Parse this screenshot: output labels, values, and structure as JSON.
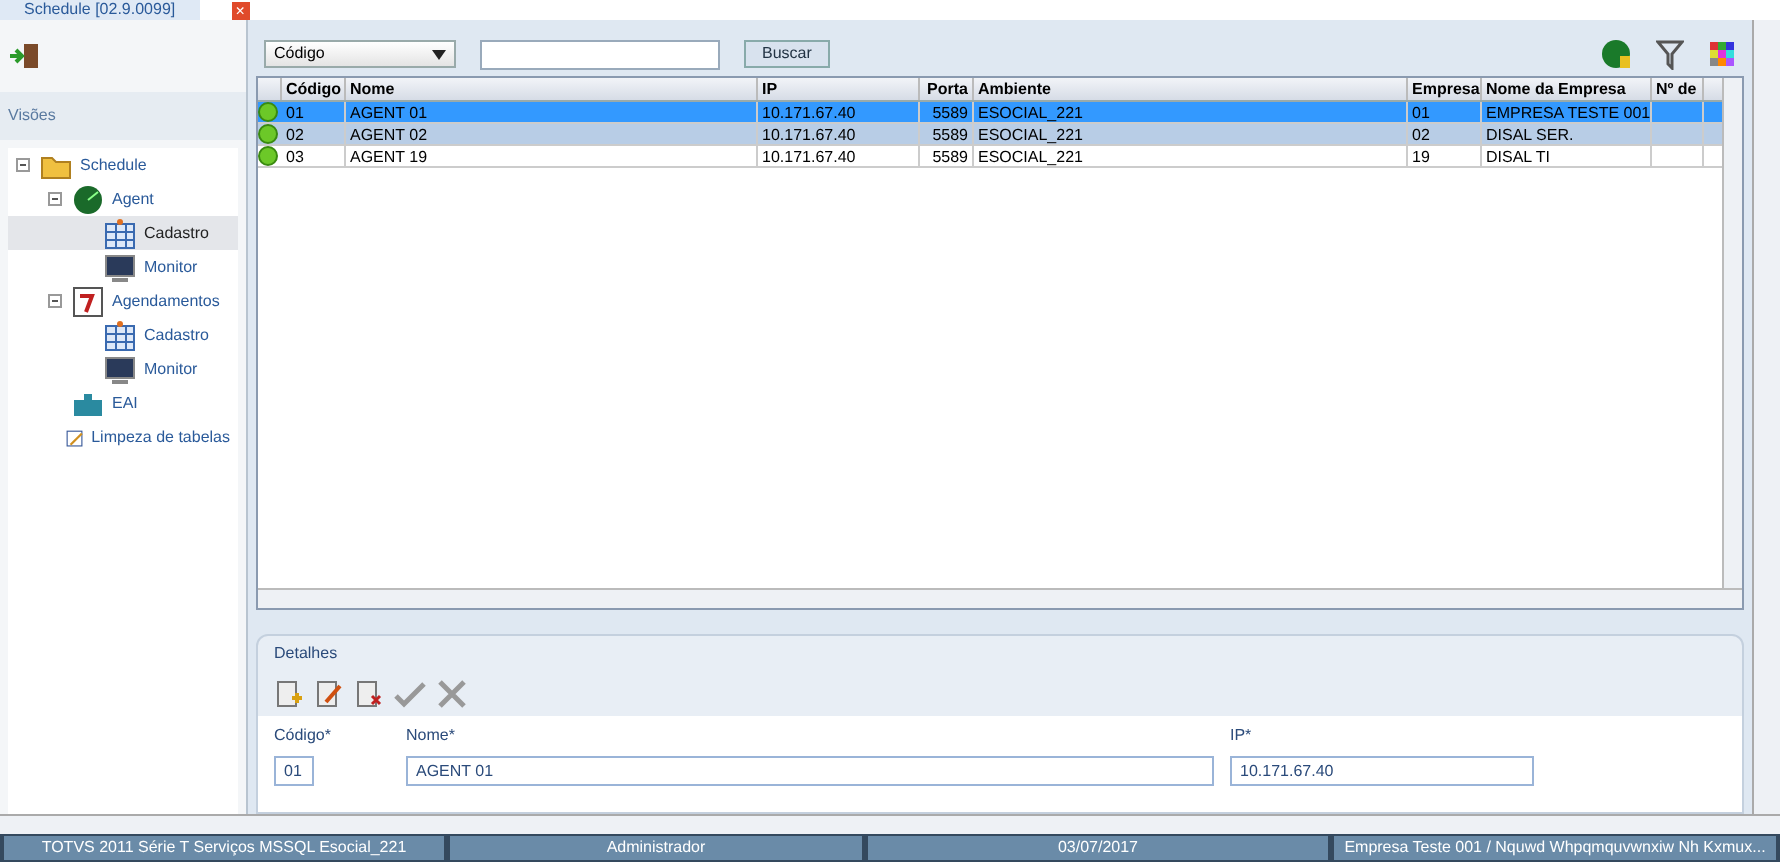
{
  "window_tab": {
    "title": "Schedule [02.9.0099]",
    "close": "×"
  },
  "sidebar": {
    "title": "Visões",
    "tree": [
      {
        "label": "Schedule",
        "kind": "folder",
        "expanded": true,
        "selected": false,
        "children": [
          {
            "label": "Agent",
            "kind": "radar",
            "expanded": true,
            "selected": false,
            "children": [
              {
                "label": "Cadastro",
                "kind": "table",
                "selected": true
              },
              {
                "label": "Monitor",
                "kind": "monitor",
                "selected": false
              }
            ]
          },
          {
            "label": "Agendamentos",
            "kind": "calendar",
            "expanded": true,
            "selected": false,
            "children": [
              {
                "label": "Cadastro",
                "kind": "table",
                "selected": false
              },
              {
                "label": "Monitor",
                "kind": "monitor",
                "selected": false
              }
            ]
          },
          {
            "label": "EAI",
            "kind": "puzzle",
            "selected": false
          },
          {
            "label": "Limpeza de tabelas",
            "kind": "broom",
            "selected": false
          }
        ]
      }
    ]
  },
  "search": {
    "field": "Código",
    "button": "Buscar"
  },
  "table": {
    "columns": [
      "Código",
      "Nome",
      "IP",
      "Porta",
      "Ambiente",
      "Empresa",
      "Nome da Empresa",
      "Nº de "
    ],
    "rows": [
      {
        "selected": true,
        "cells": [
          "01",
          "AGENT 01",
          "10.171.67.40",
          "5589",
          "ESOCIAL_221",
          "01",
          "EMPRESA TESTE 001",
          ""
        ]
      },
      {
        "selected": false,
        "highlighted": true,
        "cells": [
          "02",
          "AGENT 02",
          "10.171.67.40",
          "5589",
          "ESOCIAL_221",
          "02",
          "DISAL SER.",
          ""
        ]
      },
      {
        "selected": false,
        "highlighted": false,
        "cells": [
          "03",
          "AGENT 19",
          "10.171.67.40",
          "5589",
          "ESOCIAL_221",
          "19",
          "DISAL TI",
          ""
        ]
      }
    ]
  },
  "details": {
    "title": "Detalhes",
    "fields": [
      {
        "label": "Código*",
        "value": "01"
      },
      {
        "label": "Nome*",
        "value": "AGENT 01"
      },
      {
        "label": "IP*",
        "value": "10.171.67.40"
      }
    ]
  },
  "status_bar": [
    "TOTVS 2011  Série T Serviços MSSQL Esocial_221",
    "Administrador",
    "03/07/2017",
    "Empresa Teste 001 / Nquwd Whpqmquvwnxiw Nh Kxmux..."
  ]
}
